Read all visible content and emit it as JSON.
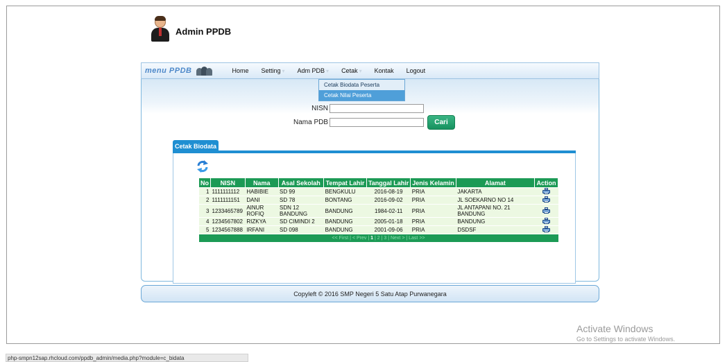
{
  "header": {
    "title": "Admin PPDB"
  },
  "nav": {
    "brand": "menu PPDB",
    "items": [
      {
        "label": "Home"
      },
      {
        "label": "Setting"
      },
      {
        "label": "Adm PDB"
      },
      {
        "label": "Cetak"
      },
      {
        "label": "Kontak"
      },
      {
        "label": "Logout"
      }
    ],
    "dropdown": [
      "Cetak Biodata Peserta",
      "Cetak Nilai Peserta"
    ]
  },
  "search": {
    "nisn_label": "NISN",
    "nama_label": "Nama PDB",
    "nisn_value": "",
    "nama_value": "",
    "button": "Cari"
  },
  "tab": {
    "label": "Cetak Biodata"
  },
  "table": {
    "headers": [
      "No",
      "NISN",
      "Nama",
      "Asal Sekolah",
      "Tempat Lahir",
      "Tanggal Lahir",
      "Jenis Kelamin",
      "Alamat",
      "Action"
    ],
    "rows": [
      {
        "no": "1",
        "nisn": "1111111112",
        "nama": "HABIBIE",
        "asal": "SD 99",
        "tempat": "BENGKULU",
        "tanggal": "2016-08-19",
        "jk": "PRIA",
        "alamat": "JAKARTA"
      },
      {
        "no": "2",
        "nisn": "1111111151",
        "nama": "DANI",
        "asal": "SD 78",
        "tempat": "BONTANG",
        "tanggal": "2016-09-02",
        "jk": "PRIA",
        "alamat": "JL SOEKARNO NO 14"
      },
      {
        "no": "3",
        "nisn": "1233465789",
        "nama": "AINUR ROFIQ",
        "asal": "SDN 12 BANDUNG",
        "tempat": "BANDUNG",
        "tanggal": "1984-02-11",
        "jk": "PRIA",
        "alamat": "JL ANTAPANI NO. 21 BANDUNG"
      },
      {
        "no": "4",
        "nisn": "1234567802",
        "nama": "RIZKYA",
        "asal": "SD CIMINDI 2",
        "tempat": "BANDUNG",
        "tanggal": "2005-01-18",
        "jk": "PRIA",
        "alamat": "BANDUNG"
      },
      {
        "no": "5",
        "nisn": "1234567888",
        "nama": "IRFANI",
        "asal": "SD 098",
        "tempat": "BANDUNG",
        "tanggal": "2001-09-06",
        "jk": "PRIA",
        "alamat": "DSDSF"
      }
    ],
    "pager": {
      "first": "<< First",
      "prev": "< Prev",
      "pages": [
        "1",
        "2",
        "3"
      ],
      "next": "Next >",
      "last": "Last >>"
    }
  },
  "footer": {
    "text": "Copyleft © 2016 SMP Negeri 5 Satu Atap Purwanegara"
  },
  "watermark": {
    "title": "Activate Windows",
    "sub": "Go to Settings to activate Windows."
  },
  "status": {
    "url": "php-smpn12sap.rhcloud.com/ppdb_admin/media.php?module=c_bidata"
  }
}
